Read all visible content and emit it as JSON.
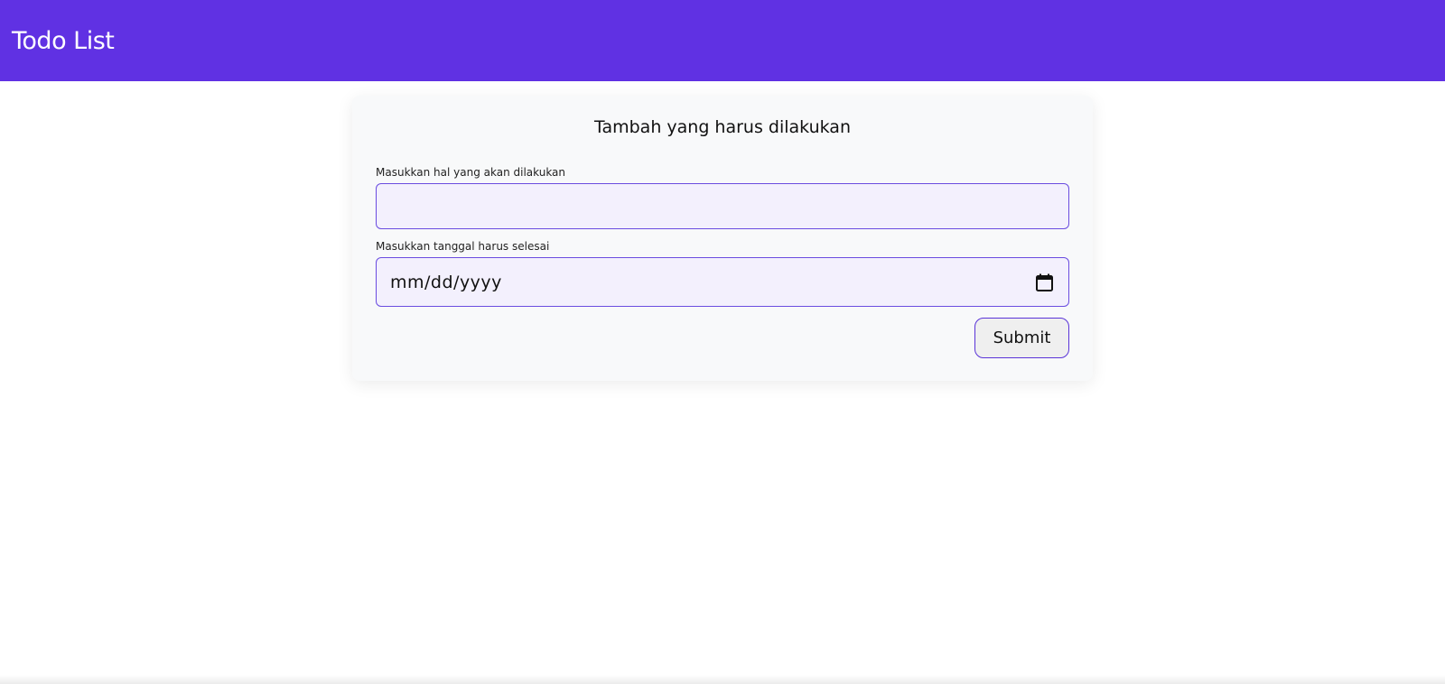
{
  "header": {
    "title": "Todo List",
    "background_color": "#6031e3"
  },
  "form": {
    "heading": "Tambah yang harus dilakukan",
    "todo_label": "Masukkan hal yang akan dilakukan",
    "todo_value": "",
    "date_label": "Masukkan tanggal harus selesai",
    "date_placeholder": "mm/dd/yyyy",
    "date_icon": "calendar-icon",
    "submit_label": "Submit",
    "accent_color": "#6a4ce0",
    "input_background": "#f3f0fd"
  }
}
